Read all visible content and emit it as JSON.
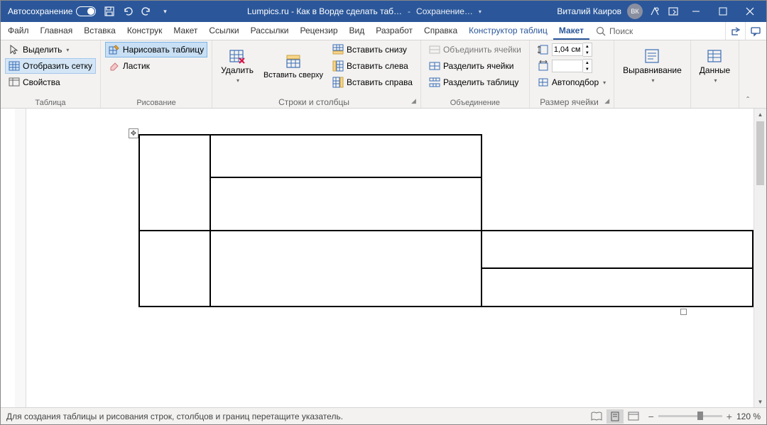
{
  "titlebar": {
    "autosave": "Автосохранение",
    "doc_title": "Lumpics.ru - Как в Ворде сделать таб…",
    "save_state": "Сохранение…",
    "user": "Виталий Каиров",
    "initials": "ВК"
  },
  "tabs": {
    "file": "Файл",
    "home": "Главная",
    "insert": "Вставка",
    "design": "Конструк",
    "layout": "Макет",
    "refs": "Ссылки",
    "mail": "Рассылки",
    "review": "Рецензир",
    "view": "Вид",
    "dev": "Разработ",
    "help": "Справка",
    "tbl_design": "Конструктор таблиц",
    "tbl_layout": "Макет",
    "search": "Поиск"
  },
  "ribbon": {
    "g_table": "Таблица",
    "g_draw": "Рисование",
    "g_rowscols": "Строки и столбцы",
    "g_merge": "Объединение",
    "g_size": "Размер ячейки",
    "g_align": "",
    "g_data": "",
    "select": "Выделить",
    "gridlines": "Отобразить сетку",
    "props": "Свойства",
    "draw": "Нарисовать таблицу",
    "eraser": "Ластик",
    "delete": "Удалить",
    "ins_above": "Вставить сверху",
    "ins_below": "Вставить снизу",
    "ins_left": "Вставить слева",
    "ins_right": "Вставить справа",
    "merge": "Объединить ячейки",
    "split": "Разделить ячейки",
    "split_tbl": "Разделить таблицу",
    "height": "1,04 см",
    "width": "",
    "autofit": "Автоподбор",
    "align": "Выравнивание",
    "data": "Данные"
  },
  "status": {
    "hint": "Для создания таблицы и рисования строк, столбцов и границ перетащите указатель.",
    "zoom": "120 %"
  }
}
